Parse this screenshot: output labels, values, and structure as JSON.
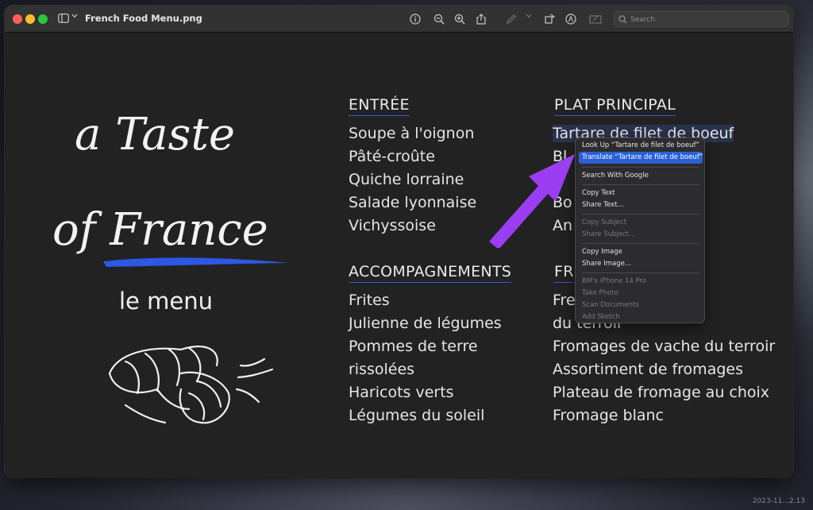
{
  "window": {
    "title": "French Food Menu.png",
    "search_placeholder": "Search"
  },
  "desktop": {
    "caption": "2023-11...2.13"
  },
  "menu_image": {
    "logo_line1": "a Taste",
    "logo_line2": "of France",
    "subtitle": "le menu",
    "sections": [
      {
        "title": "ENTRÉE",
        "items": [
          "Soupe à l'oignon",
          "Pâté-croûte",
          "Quiche lorraine",
          "Salade lyonnaise",
          "Vichyssoise"
        ]
      },
      {
        "title": "PLAT PRINCIPAL",
        "items": [
          "Tartare de filet de boeuf",
          "Bl",
          "",
          "Bo",
          "An"
        ]
      },
      {
        "title": "ACCOMPAGNEMENTS",
        "items": [
          "Frites",
          "Julienne de légumes",
          "Pommes de terre",
          "rissolées",
          "Haricots verts",
          "Légumes du soleil"
        ]
      },
      {
        "title": "FR",
        "items": [
          "Fre",
          "du terroir",
          "Fromages de vache du terroir",
          "Assortiment de fromages",
          "Plateau de fromage au choix",
          "Fromage blanc"
        ]
      }
    ]
  },
  "context_menu": {
    "items": [
      {
        "label": "Look Up “Tartare de filet de boeuf”",
        "disabled": false,
        "highlighted": false
      },
      {
        "label": "Translate “Tartare de filet de boeuf”",
        "disabled": false,
        "highlighted": true
      },
      {
        "label": "Search With Google",
        "disabled": false,
        "highlighted": false
      },
      {
        "label": "Copy Text",
        "disabled": false,
        "highlighted": false
      },
      {
        "label": "Share Text...",
        "disabled": false,
        "highlighted": false
      },
      {
        "label": "Copy Subject",
        "disabled": true,
        "highlighted": false
      },
      {
        "label": "Share Subject...",
        "disabled": true,
        "highlighted": false
      },
      {
        "label": "Copy Image",
        "disabled": false,
        "highlighted": false
      },
      {
        "label": "Share Image...",
        "disabled": false,
        "highlighted": false
      },
      {
        "label": "BM's iPhone 14 Pro",
        "disabled": true,
        "highlighted": false
      },
      {
        "label": "Take Photo",
        "disabled": true,
        "highlighted": false
      },
      {
        "label": "Scan Documents",
        "disabled": true,
        "highlighted": false
      },
      {
        "label": "Add Sketch",
        "disabled": true,
        "highlighted": false
      }
    ]
  },
  "colors": {
    "accent_underline": "#3a55d8",
    "highlight": "#2a60d8",
    "arrow": "#9b3df0"
  },
  "icons": [
    "sidebar-toggle-icon",
    "chevron-down-icon",
    "info-icon",
    "zoom-out-icon",
    "zoom-in-icon",
    "share-icon",
    "markup-pen-icon",
    "rotate-icon",
    "annotate-icon",
    "form-fill-icon",
    "search-icon"
  ]
}
